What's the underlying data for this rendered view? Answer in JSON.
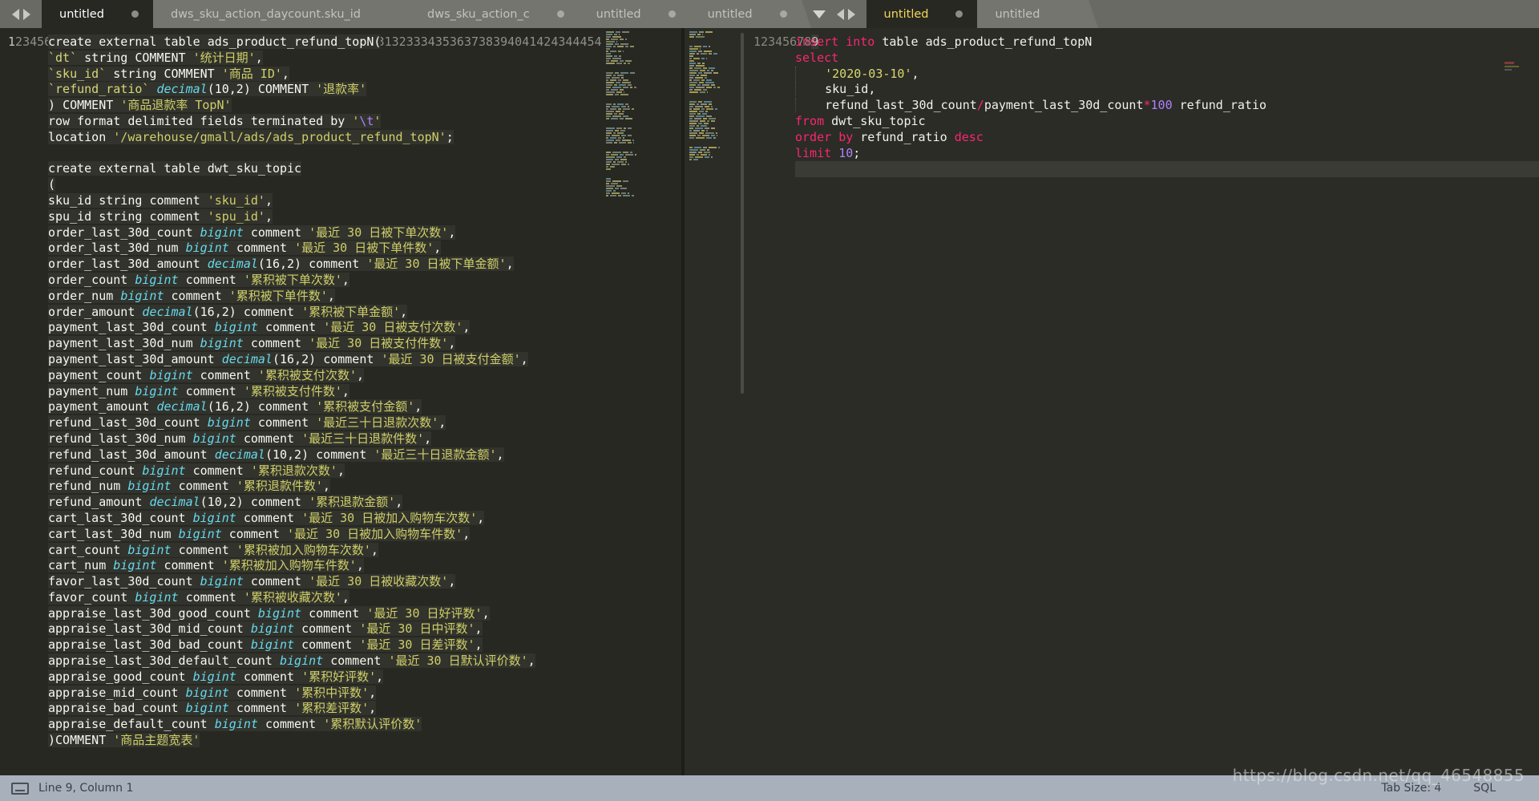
{
  "window": {
    "app": "Sublime Text",
    "watermark": "https://blog.csdn.net/qq_46548855"
  },
  "tabbar": {
    "nav_prev_icon": "arrow-left-icon",
    "nav_next_icon": "arrow-right-icon",
    "left_group": [
      {
        "label": "untitled",
        "active": true,
        "dirty": true
      },
      {
        "label": "dws_sku_action_daycount.sku_id",
        "active": false,
        "dirty": false
      },
      {
        "label": "dws_sku_action_c",
        "active": false,
        "dirty": true
      },
      {
        "label": "untitled",
        "active": false,
        "dirty": true
      },
      {
        "label": "untitled",
        "active": false,
        "dirty": true
      }
    ],
    "mid_nav": {
      "dropdown_icon": "chevron-down-icon",
      "prev_icon": "arrow-left-icon",
      "next_icon": "arrow-right-icon"
    },
    "right_group": [
      {
        "label": "untitled",
        "active": true,
        "dirty": true
      },
      {
        "label": "untitled",
        "active": false,
        "dirty": false
      }
    ]
  },
  "left_editor": {
    "language": "SQL",
    "first_line": 1,
    "lines": [
      "create external table ads_product_refund_topN(",
      "`dt` string COMMENT '统计日期',",
      "`sku_id` string COMMENT '商品 ID',",
      "`refund_ratio` decimal(10,2) COMMENT '退款率'",
      ") COMMENT '商品退款率 TopN'",
      "row format delimited fields terminated by '\\t'",
      "location '/warehouse/gmall/ads/ads_product_refund_topN';",
      "",
      "create external table dwt_sku_topic",
      "(",
      "sku_id string comment 'sku_id',",
      "spu_id string comment 'spu_id',",
      "order_last_30d_count bigint comment '最近 30 日被下单次数',",
      "order_last_30d_num bigint comment '最近 30 日被下单件数',",
      "order_last_30d_amount decimal(16,2) comment '最近 30 日被下单金额',",
      "order_count bigint comment '累积被下单次数',",
      "order_num bigint comment '累积被下单件数',",
      "order_amount decimal(16,2) comment '累积被下单金额',",
      "payment_last_30d_count bigint comment '最近 30 日被支付次数',",
      "payment_last_30d_num bigint comment '最近 30 日被支付件数',",
      "payment_last_30d_amount decimal(16,2) comment '最近 30 日被支付金额',",
      "payment_count bigint comment '累积被支付次数',",
      "payment_num bigint comment '累积被支付件数',",
      "payment_amount decimal(16,2) comment '累积被支付金额',",
      "refund_last_30d_count bigint comment '最近三十日退款次数',",
      "refund_last_30d_num bigint comment '最近三十日退款件数',",
      "refund_last_30d_amount decimal(10,2) comment '最近三十日退款金额',",
      "refund_count bigint comment '累积退款次数',",
      "refund_num bigint comment '累积退款件数',",
      "refund_amount decimal(10,2) comment '累积退款金额',",
      "cart_last_30d_count bigint comment '最近 30 日被加入购物车次数',",
      "cart_last_30d_num bigint comment '最近 30 日被加入购物车件数',",
      "cart_count bigint comment '累积被加入购物车次数',",
      "cart_num bigint comment '累积被加入购物车件数',",
      "favor_last_30d_count bigint comment '最近 30 日被收藏次数',",
      "favor_count bigint comment '累积被收藏次数',",
      "appraise_last_30d_good_count bigint comment '最近 30 日好评数',",
      "appraise_last_30d_mid_count bigint comment '最近 30 日中评数',",
      "appraise_last_30d_bad_count bigint comment '最近 30 日差评数',",
      "appraise_last_30d_default_count bigint comment '最近 30 日默认评价数',",
      "appraise_good_count bigint comment '累积好评数',",
      "appraise_mid_count bigint comment '累积中评数',",
      "appraise_bad_count bigint comment '累积差评数',",
      "appraise_default_count bigint comment '累积默认评价数'",
      ")COMMENT '商品主题宽表'",
      "",
      ""
    ]
  },
  "right_editor": {
    "language": "SQL",
    "lines": [
      "insert into table ads_product_refund_topN",
      "select",
      "    '2020-03-10',",
      "    sku_id,",
      "    refund_last_30d_count/payment_last_30d_count*100 refund_ratio",
      "from dwt_sku_topic",
      "order by refund_ratio desc",
      "limit 10;",
      ""
    ]
  },
  "status_bar": {
    "keyboard_icon": "keyboard-icon",
    "cursor_position": "Line 9, Column 1",
    "tab_size": "Tab Size: 4",
    "syntax": "SQL"
  },
  "colors": {
    "editor_bg": "#272822",
    "tabbar_bg": "#6a6a64",
    "keyword_pink": "#f92672",
    "string_yellow": "#cfcf6a",
    "type_blue": "#66d9ef",
    "number_purple": "#ae81ff",
    "status_bg": "#a8b0bb"
  }
}
